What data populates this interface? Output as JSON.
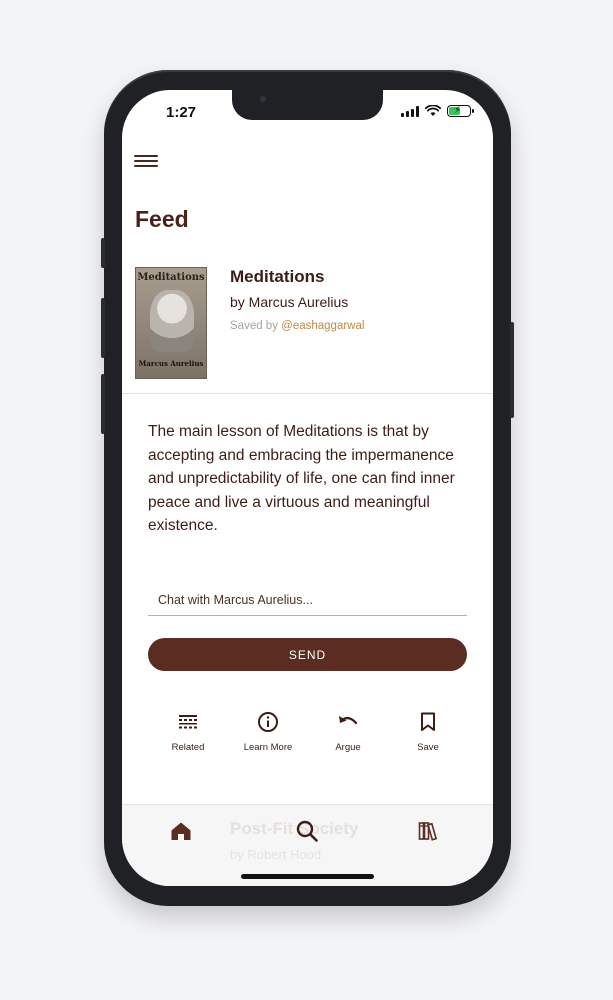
{
  "status_bar": {
    "time": "1:27"
  },
  "page": {
    "title": "Feed"
  },
  "book": {
    "title": "Meditations",
    "author": "by Marcus Aurelius",
    "saved_by_prefix": "Saved by",
    "saved_by_user": "@eashaggarwal",
    "cover_title": "Meditations",
    "cover_author": "Marcus Aurelius"
  },
  "summary": "The main lesson of Meditations is that by accepting and embracing the impermanence and unpredictability of life, one can find inner peace and live a virtuous and meaningful existence.",
  "chat": {
    "placeholder": "Chat with Marcus Aurelius...",
    "send_label": "SEND"
  },
  "actions": [
    {
      "label": "Related",
      "icon": "list-icon"
    },
    {
      "label": "Learn More",
      "icon": "info-icon"
    },
    {
      "label": "Argue",
      "icon": "undo-icon"
    },
    {
      "label": "Save",
      "icon": "bookmark-icon"
    }
  ],
  "next_card": {
    "title": "Post-Fit Society",
    "author": "by Robert Hood"
  },
  "tabs": [
    {
      "name": "home",
      "icon": "home-icon",
      "active": true
    },
    {
      "name": "search",
      "icon": "search-icon"
    },
    {
      "name": "library",
      "icon": "books-icon"
    }
  ],
  "colors": {
    "primary": "#5b2c22",
    "text": "#3e1d14",
    "accent": "#c48a4a"
  }
}
